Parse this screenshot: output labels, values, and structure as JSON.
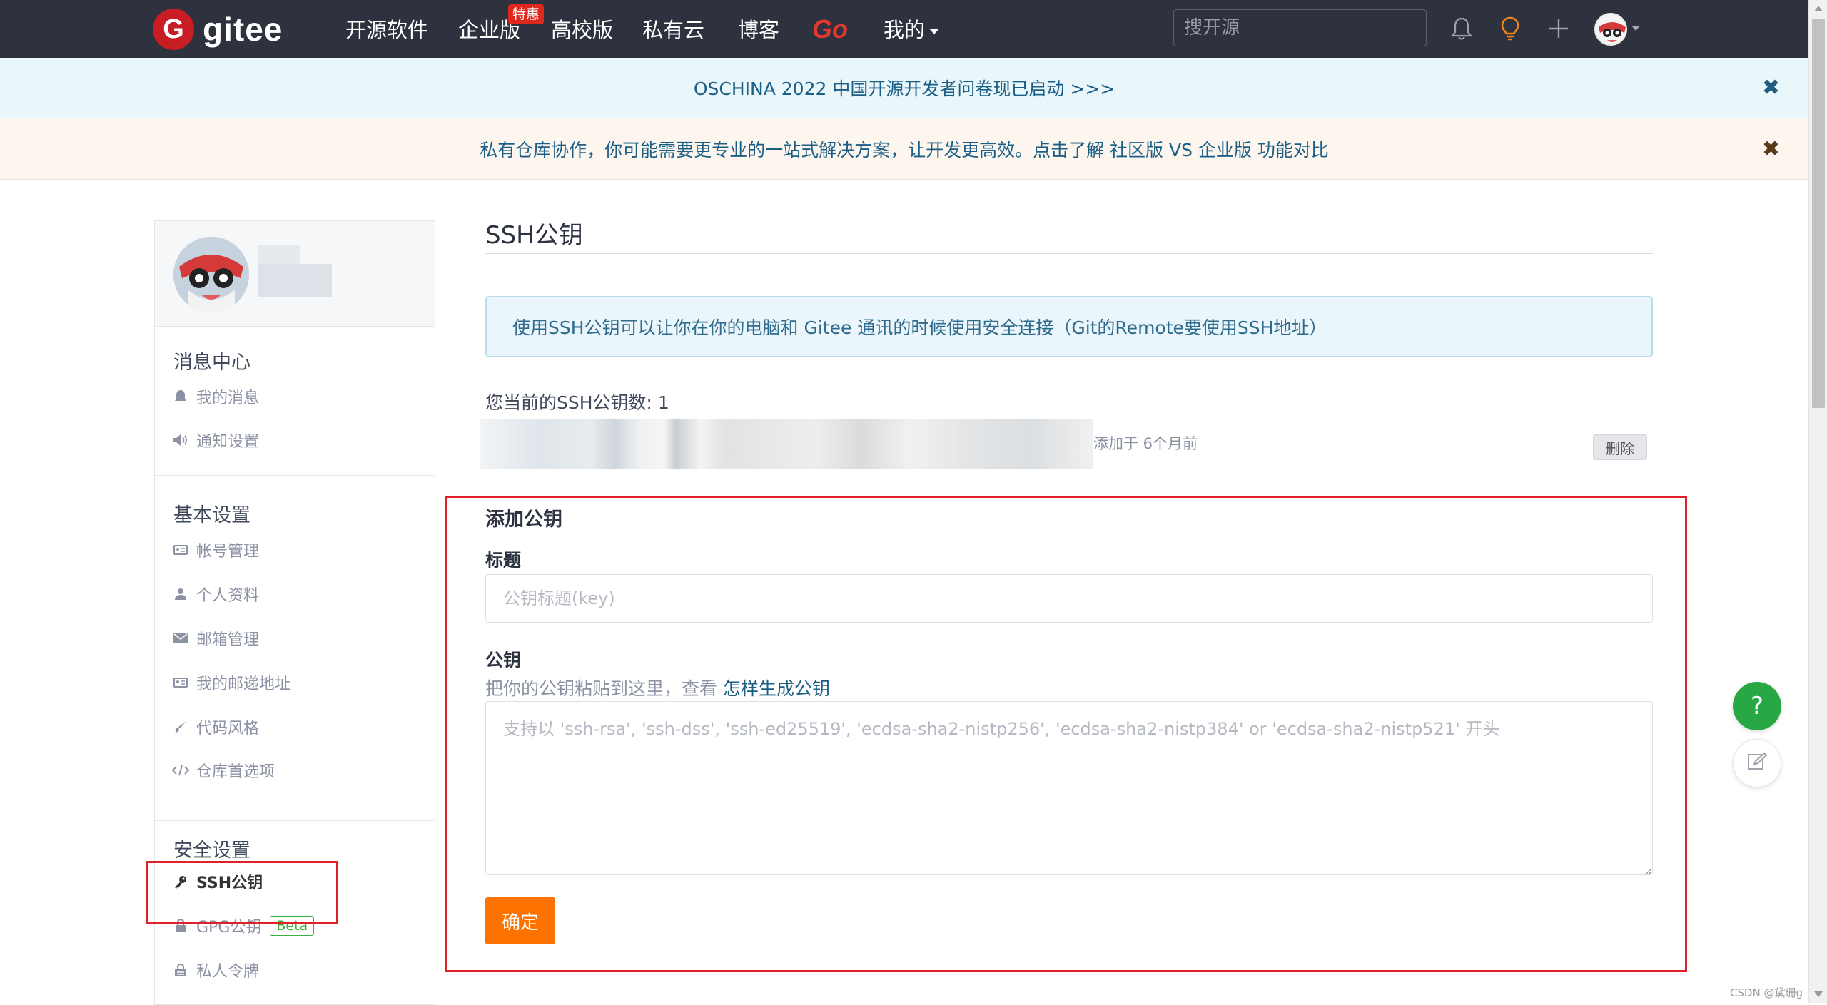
{
  "nav": {
    "logo_text": "gitee",
    "items": [
      "开源软件",
      "企业版",
      "高校版",
      "私有云",
      "博客",
      "Go",
      "我的"
    ],
    "badge": "特惠",
    "search_placeholder": "搜开源"
  },
  "banners": {
    "survey": "OSCHINA 2022 中国开源开发者问卷现已启动 >>>",
    "enterprise": "私有仓库协作，你可能需要更专业的一站式解决方案，让开发更高效。点击了解 社区版 VS 企业版 功能对比",
    "close_symbol": "✖"
  },
  "sidebar": {
    "sections": [
      {
        "title": "消息中心",
        "items": [
          "我的消息",
          "通知设置"
        ]
      },
      {
        "title": "基本设置",
        "items": [
          "帐号管理",
          "个人资料",
          "邮箱管理",
          "我的邮递地址",
          "代码风格",
          "仓库首选项"
        ]
      },
      {
        "title": "安全设置",
        "items": [
          "SSH公钥",
          "GPG公钥",
          "私人令牌"
        ]
      }
    ],
    "beta_label": "Beta"
  },
  "main": {
    "title": "SSH公钥",
    "info": "使用SSH公钥可以让你在你的电脑和 Gitee 通讯的时候使用安全连接（Git的Remote要使用SSH地址）",
    "count_label": "您当前的SSH公钥数: 1",
    "key_added": "添加于 6个月前",
    "delete_label": "删除",
    "add_title": "添加公钥",
    "label_title": "标题",
    "title_placeholder": "公钥标题(key)",
    "label_key": "公钥",
    "key_hint": "把你的公钥粘贴到这里，查看 ",
    "key_hint_link": "怎样生成公钥",
    "key_placeholder": "支持以 'ssh-rsa', 'ssh-dss', 'ssh-ed25519', 'ecdsa-sha2-nistp256', 'ecdsa-sha2-nistp384' or 'ecdsa-sha2-nistp521' 开头",
    "submit_label": "确定"
  },
  "floating": {
    "help_symbol": "?"
  },
  "watermark": "CSDN @黛珊g"
}
